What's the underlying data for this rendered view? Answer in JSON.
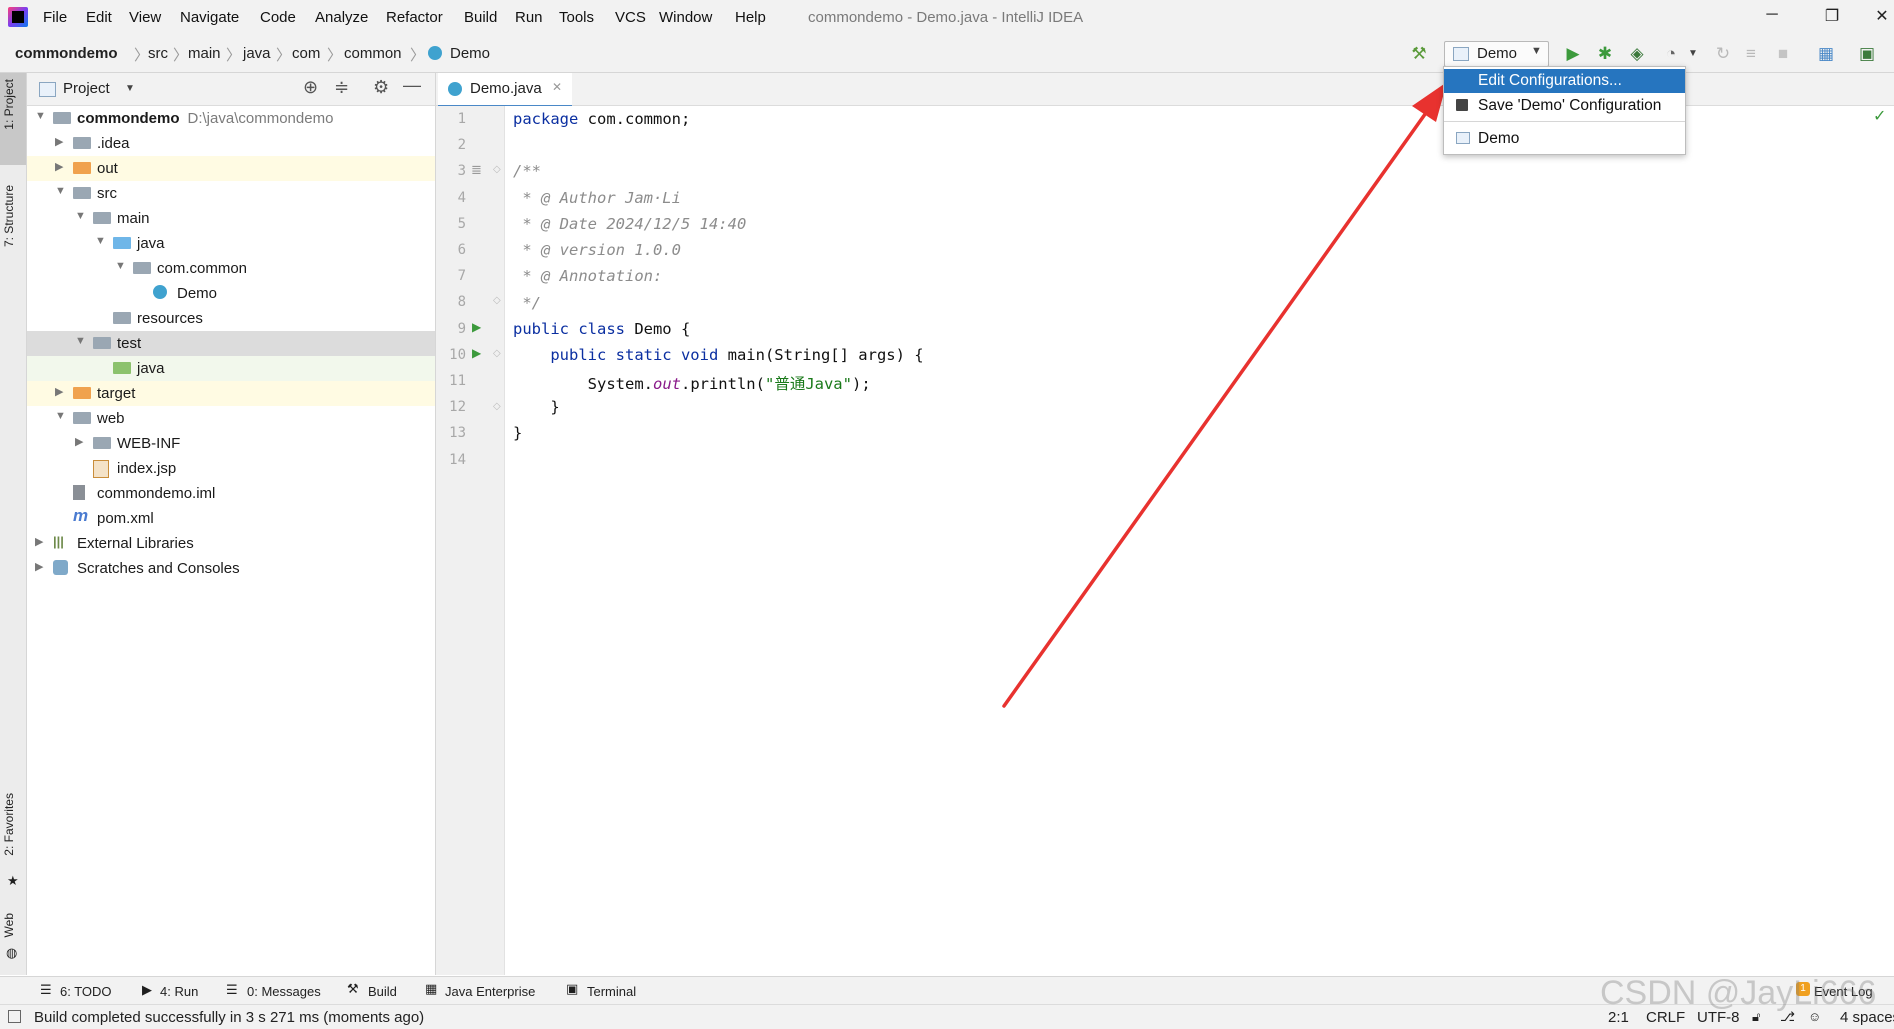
{
  "menu": {
    "items": [
      "File",
      "Edit",
      "View",
      "Navigate",
      "Code",
      "Analyze",
      "Refactor",
      "Build",
      "Run",
      "Tools",
      "VCS",
      "Window",
      "Help"
    ],
    "app_title": "commondemo - Demo.java - IntelliJ IDEA"
  },
  "window_controls": {
    "minimize": "─",
    "restore": "❐",
    "close": "✕"
  },
  "breadcrumb": [
    "commondemo",
    "src",
    "main",
    "java",
    "com",
    "common",
    "Demo"
  ],
  "toolbar": {
    "run_config": "Demo"
  },
  "left_stripe": {
    "project": "1: Project",
    "structure": "7: Structure",
    "favorites": "2: Favorites",
    "web": "Web"
  },
  "project_panel": {
    "title": "Project"
  },
  "tree": [
    {
      "label": "commondemo",
      "path": "D:\\java\\commondemo",
      "bold": true,
      "depth": 0,
      "arrow": "▼",
      "icon": "module"
    },
    {
      "label": ".idea",
      "depth": 1,
      "arrow": "▶",
      "icon": "folder"
    },
    {
      "label": "out",
      "depth": 1,
      "arrow": "▶",
      "icon": "folder-orange"
    },
    {
      "label": "src",
      "depth": 1,
      "arrow": "▼",
      "icon": "folder"
    },
    {
      "label": "main",
      "depth": 2,
      "arrow": "▼",
      "icon": "folder"
    },
    {
      "label": "java",
      "depth": 3,
      "arrow": "▼",
      "icon": "folder-blue"
    },
    {
      "label": "com.common",
      "depth": 4,
      "arrow": "▼",
      "icon": "package"
    },
    {
      "label": "Demo",
      "depth": 5,
      "arrow": "",
      "icon": "class"
    },
    {
      "label": "resources",
      "depth": 3,
      "arrow": "",
      "icon": "folder-res"
    },
    {
      "label": "test",
      "depth": 2,
      "arrow": "▼",
      "icon": "folder"
    },
    {
      "label": "java",
      "depth": 3,
      "arrow": "",
      "icon": "folder-green"
    },
    {
      "label": "target",
      "depth": 1,
      "arrow": "▶",
      "icon": "folder-orange"
    },
    {
      "label": "web",
      "depth": 1,
      "arrow": "▼",
      "icon": "folder-web"
    },
    {
      "label": "WEB-INF",
      "depth": 2,
      "arrow": "▶",
      "icon": "folder"
    },
    {
      "label": "index.jsp",
      "depth": 2,
      "arrow": "",
      "icon": "jsp"
    },
    {
      "label": "commondemo.iml",
      "depth": 1,
      "arrow": "",
      "icon": "iml"
    },
    {
      "label": "pom.xml",
      "depth": 1,
      "arrow": "",
      "icon": "maven"
    },
    {
      "label": "External Libraries",
      "depth": 0,
      "arrow": "▶",
      "icon": "libraries"
    },
    {
      "label": "Scratches and Consoles",
      "depth": 0,
      "arrow": "▶",
      "icon": "scratches"
    }
  ],
  "editor": {
    "tab_label": "Demo.java",
    "line_numbers": [
      "1",
      "2",
      "3",
      "4",
      "5",
      "6",
      "7",
      "8",
      "9",
      "10",
      "11",
      "12",
      "13",
      "14"
    ],
    "code": {
      "l1_kw": "package",
      "l1_rest": " com.common;",
      "l3": "/**",
      "l4": " * @ Author Jam·Li",
      "l5": " * @ Date 2024/12/5 14:40",
      "l6": " * @ version 1.0.0",
      "l7": " * @ Annotation:",
      "l8": " */",
      "l9_kw": "public class",
      "l9_rest": " Demo {",
      "l10_kw": "    public static void",
      "l10_rest": " main(String[] args) {",
      "l11_a": "        System.",
      "l11_out": "out",
      "l11_b": ".println(",
      "l11_str": "\"普通Java\"",
      "l11_c": ");",
      "l12": "    }",
      "l13": "}"
    }
  },
  "dropdown": {
    "items": [
      "Edit Configurations...",
      "Save 'Demo' Configuration",
      "Demo"
    ]
  },
  "bottom_tabs": [
    "6: TODO",
    "4: Run",
    "0: Messages",
    "Build",
    "Java Enterprise",
    "Terminal",
    "Event Log"
  ],
  "status": {
    "message": "Build completed successfully in 3 s 271 ms (moments ago)",
    "position": "2:1",
    "line_sep": "CRLF",
    "encoding": "UTF-8",
    "indent": "4 spaces"
  },
  "watermark": "CSDN @JayLi666",
  "colors": {
    "accent": "#2675bf",
    "arrow": "#e8322f",
    "run_green": "#3c9a3c"
  }
}
